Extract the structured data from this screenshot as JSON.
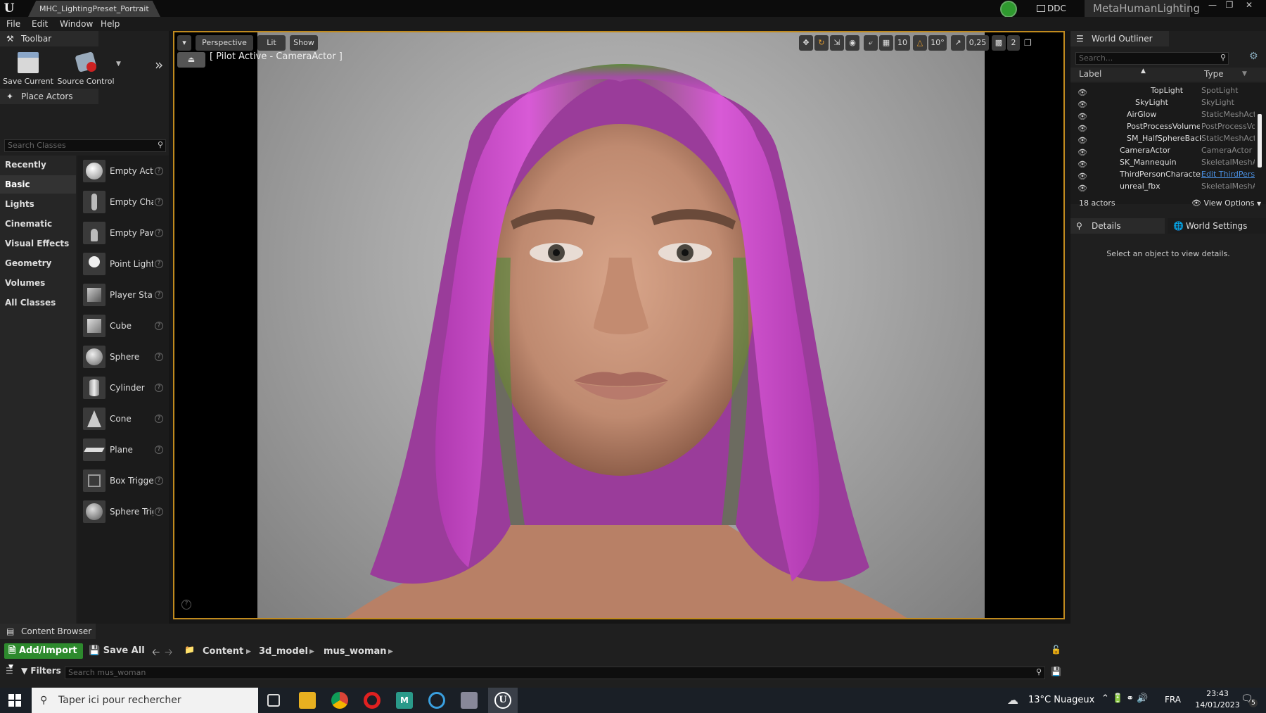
{
  "titlebar": {
    "tab": "MHC_LightingPreset_Portrait",
    "ddc": "DDC",
    "project": "MetaHumanLighting"
  },
  "menu": [
    "File",
    "Edit",
    "Window",
    "Help"
  ],
  "toolbar": {
    "tab": "Toolbar",
    "save_current": "Save Current",
    "source_control": "Source Control"
  },
  "place_actors": {
    "tab": "Place Actors",
    "search_placeholder": "Search Classes",
    "categories": [
      "Recently Placed",
      "Basic",
      "Lights",
      "Cinematic",
      "Visual Effects",
      "Geometry",
      "Volumes",
      "All Classes"
    ],
    "active_category": "Basic",
    "items": [
      "Empty Actor",
      "Empty Character",
      "Empty Pawn",
      "Point Light",
      "Player Start",
      "Cube",
      "Sphere",
      "Cylinder",
      "Cone",
      "Plane",
      "Box Trigger",
      "Sphere Trigger"
    ]
  },
  "viewport": {
    "perspective": "Perspective",
    "lit": "Lit",
    "show": "Show",
    "pilot": "[ Pilot Active - CameraActor ]",
    "grid_snap": "10",
    "rot_snap": "10°",
    "scale_snap": "0,25",
    "cam_speed": "2"
  },
  "outliner": {
    "tab": "World Outliner",
    "search_placeholder": "Search...",
    "col_label": "Label",
    "col_type": "Type",
    "rows": [
      {
        "label": "TopLight",
        "type": "SpotLight"
      },
      {
        "label": "SkyLight",
        "type": "SkyLight"
      },
      {
        "label": "AirGlow",
        "type": "StaticMeshActor"
      },
      {
        "label": "PostProcessVolume",
        "type": "PostProcessVolume"
      },
      {
        "label": "SM_HalfSphereBackground",
        "type": "StaticMeshActor"
      },
      {
        "label": "CameraActor",
        "type": "CameraActor"
      },
      {
        "label": "SK_Mannequin",
        "type": "SkeletalMeshActor"
      },
      {
        "label": "ThirdPersonCharacter",
        "type": "Edit ThirdPersonCharacter"
      },
      {
        "label": "unreal_fbx",
        "type": "SkeletalMeshActor"
      }
    ],
    "count": "18 actors",
    "view_options": "View Options"
  },
  "details": {
    "tab_details": "Details",
    "tab_world": "World Settings",
    "empty_message": "Select an object to view details."
  },
  "content_browser": {
    "tab": "Content Browser",
    "add_import": "Add/Import",
    "save_all": "Save All",
    "path": [
      "Content",
      "3d_model",
      "mus_woman"
    ],
    "filters": "Filters",
    "search_placeholder": "Search mus_woman"
  },
  "taskbar": {
    "search": "Taper ici pour rechercher",
    "weather": "13°C  Nuageux",
    "lang": "FRA",
    "time": "23:43",
    "date": "14/01/2023",
    "notif": "5"
  },
  "colors": {
    "accent_border": "#c08a1e",
    "hair_primary": "#d24fd0",
    "hair_secondary": "#4f8a3a",
    "link": "#4a8fe0"
  }
}
